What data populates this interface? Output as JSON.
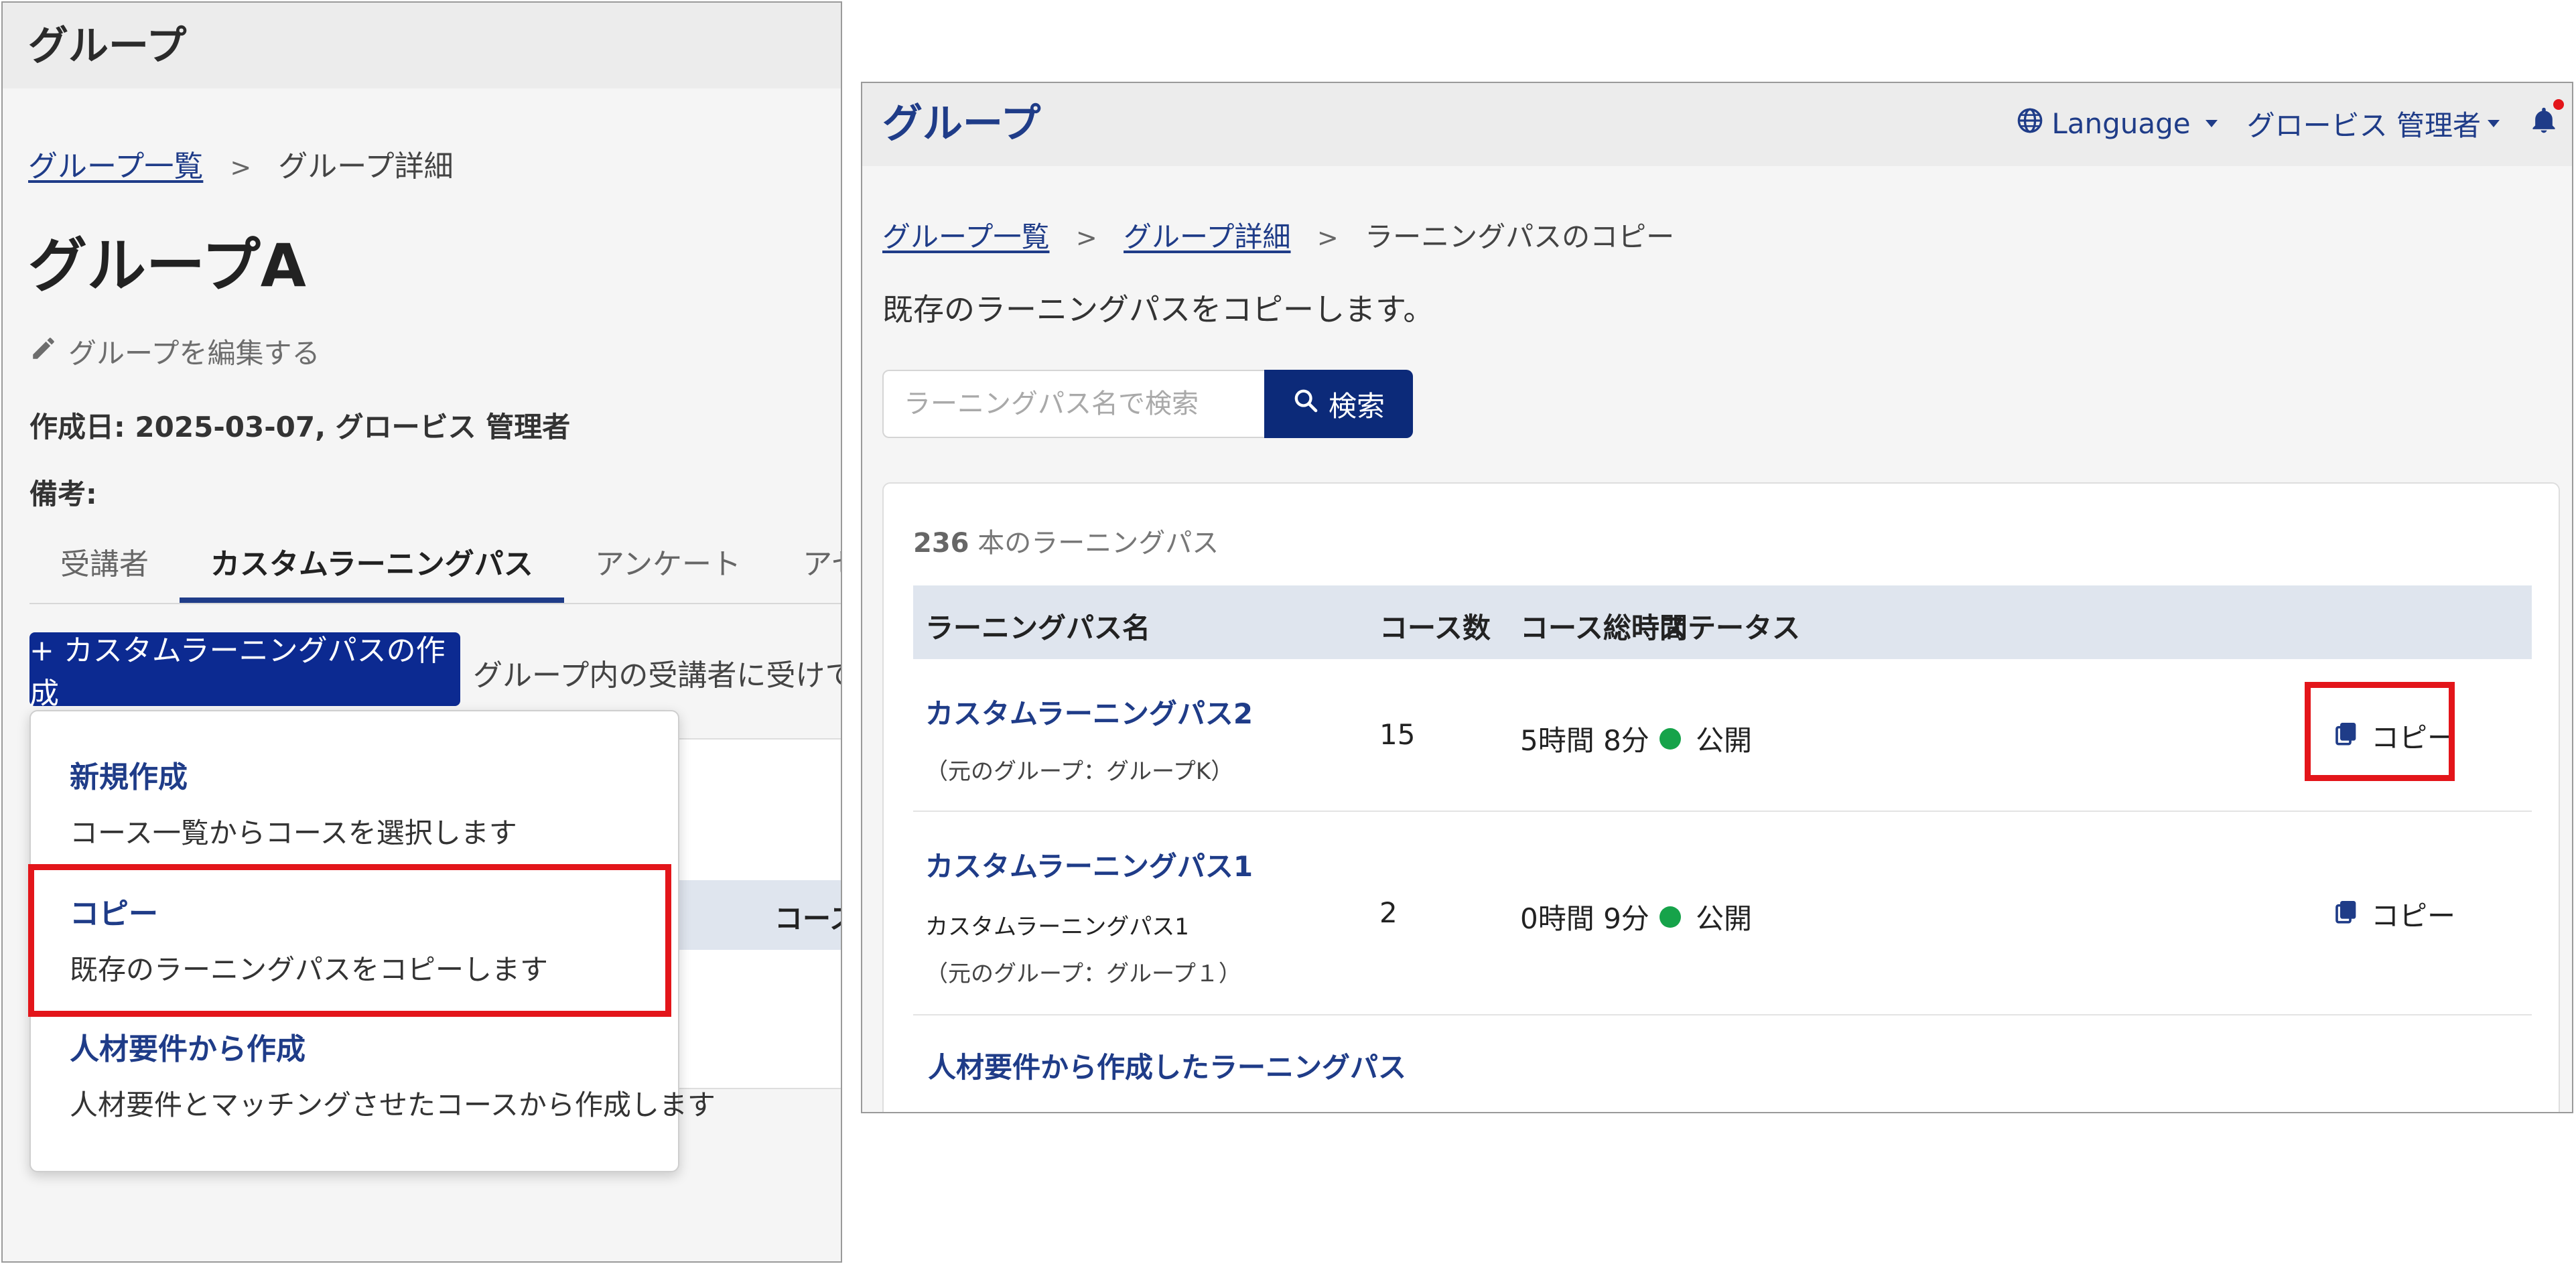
{
  "left": {
    "app_title": "グループ",
    "breadcrumb": {
      "list": "グループ一覧",
      "sep": ">",
      "current": "グループ詳細"
    },
    "page_title": "グループA",
    "edit_link": "グループを編集する",
    "created": "作成日: 2025-03-07, グロービス 管理者",
    "notes_label": "備考:",
    "tabs": [
      "受講者",
      "カスタムラーニングパス",
      "アンケート",
      "アセスメント"
    ],
    "active_tab": 1,
    "create_button": "+ カスタムラーニングパスの作成",
    "create_desc": "グループ内の受講者に受けても",
    "bg_column": "コース",
    "menu": [
      {
        "title": "新規作成",
        "desc": "コース一覧からコースを選択します"
      },
      {
        "title": "コピー",
        "desc": "既存のラーニングパスをコピーします"
      },
      {
        "title": "人材要件から作成",
        "desc": "人材要件とマッチングさせたコースから作成します"
      }
    ]
  },
  "right": {
    "app_title": "グループ",
    "nav": {
      "language": "Language",
      "user": "グロービス 管理者"
    },
    "breadcrumb": {
      "list": "グループ一覧",
      "detail": "グループ詳細",
      "current": "ラーニングパスのコピー",
      "sep": ">"
    },
    "intro": "既存のラーニングパスをコピーします。",
    "search": {
      "placeholder": "ラーニングパス名で検索",
      "button": "検索"
    },
    "count": {
      "number": "236",
      "suffix": "本のラーニングパス"
    },
    "columns": [
      "ラーニングパス名",
      "コース数",
      "コース総時間",
      "ステータス"
    ],
    "rows": [
      {
        "name": "カスタムラーニングパス2",
        "desc": "",
        "origin": "（元のグループ：グループK）",
        "courses": "15",
        "time": "5時間 8分",
        "status": "公開",
        "action": "コピー"
      },
      {
        "name": "カスタムラーニングパス1",
        "desc": "カスタムラーニングパス1",
        "origin": "（元のグループ：グループ１）",
        "courses": "2",
        "time": "0時間 9分",
        "status": "公開",
        "action": "コピー"
      },
      {
        "name": "人材要件から作成したラーニングパス"
      }
    ]
  },
  "colors": {
    "primary": "#1f3c88",
    "button_dark": "#0c2a91",
    "highlight": "#e3151a",
    "status_green": "#16a34a",
    "table_header": "#dfe5ee"
  }
}
